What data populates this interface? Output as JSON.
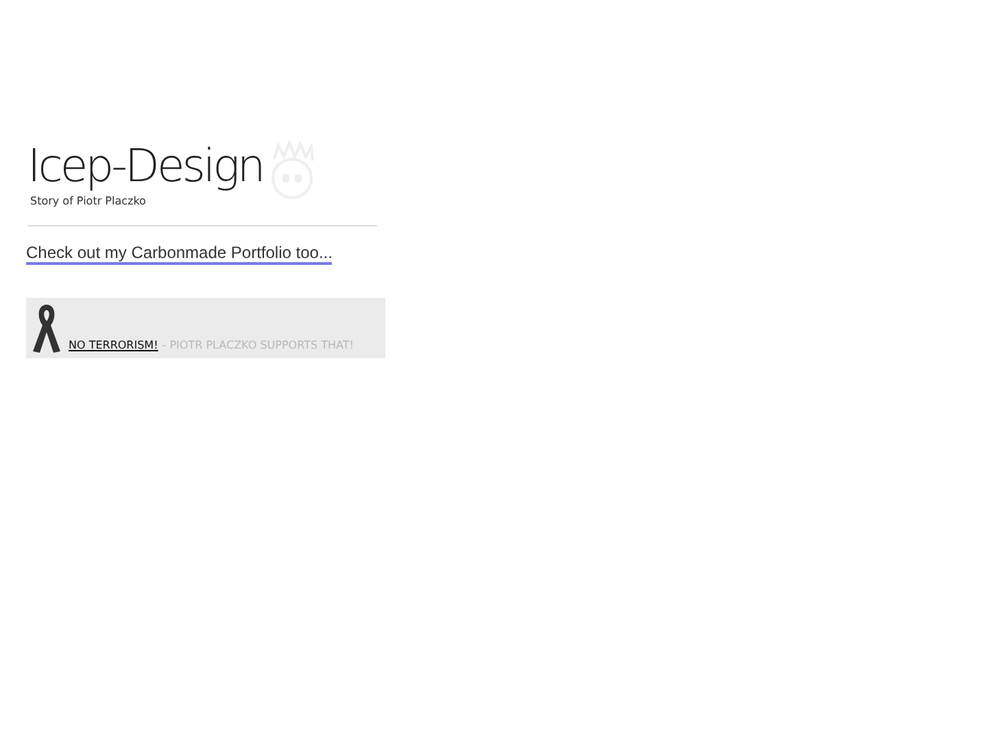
{
  "logo": {
    "title": "Icep-Design",
    "tagline": "Story of Piotr Placzko"
  },
  "portfolio_link": "Check out my Carbonmade Portfolio too...",
  "banner": {
    "link": "NO TERRORISM!",
    "text": "- PIOTR PLACZKO SUPPORTS THAT!"
  }
}
